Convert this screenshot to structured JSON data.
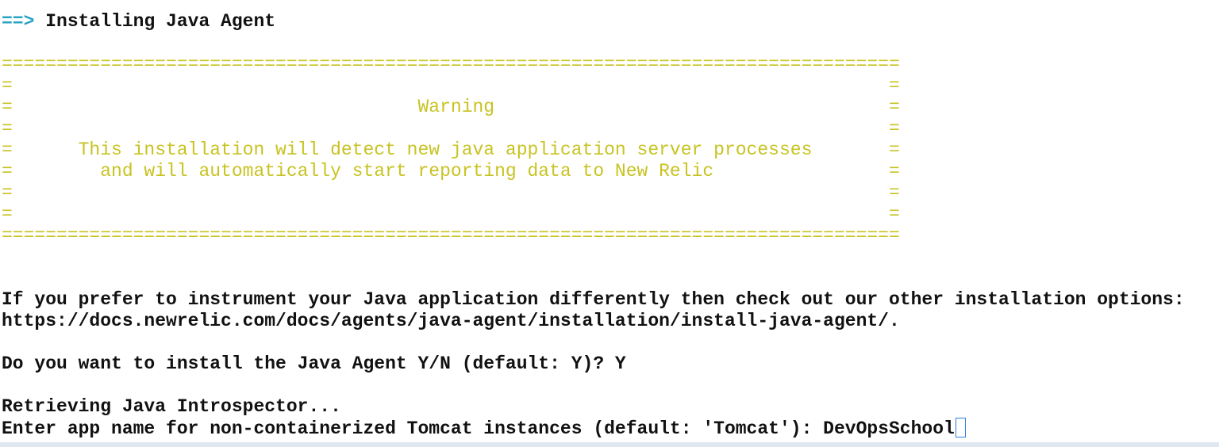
{
  "header": {
    "arrow": "==>",
    "title": " Installing Java Agent"
  },
  "banner": {
    "border": "==================================================================================",
    "blank_row": "=                                                                                =",
    "title_row": "=                                     Warning                                    =",
    "message_row_1": "=      This installation will detect new java application server processes       =",
    "message_row_2": "=        and will automatically start reporting data to New Relic                =",
    "title": "Warning",
    "message_1": "This installation will detect new java application server processes",
    "message_2": "and will automatically start reporting data to New Relic"
  },
  "output": {
    "prefer_line": "If you prefer to instrument your Java application differently then check out our other installation options:",
    "docs_url": "https://docs.newrelic.com/docs/agents/java-agent/installation/install-java-agent/.",
    "install_prompt": "Do you want to install the Java Agent Y/N (default: Y)? Y",
    "retrieving": "Retrieving Java Introspector...",
    "app_name_prompt": "Enter app name for non-containerized Tomcat instances (default: 'Tomcat'): ",
    "app_name_value": "DevOpsSchool"
  }
}
